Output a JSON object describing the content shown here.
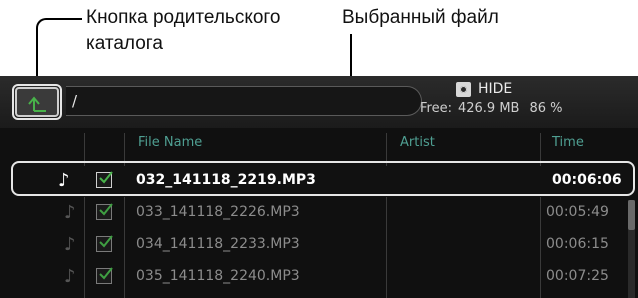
{
  "callouts": {
    "parent_dir_line1": "Кнопка родительского",
    "parent_dir_line2": "каталога",
    "selected_file": "Выбранный файл"
  },
  "toolbar": {
    "path": "/",
    "hide_label": "HIDE",
    "free_label": "Free:",
    "free_size": "426.9 MB",
    "free_percent": "86 %"
  },
  "table": {
    "columns": [
      "File Name",
      "Artist",
      "Time"
    ],
    "rows": [
      {
        "file": "032_141118_2219.MP3",
        "artist": "",
        "time": "00:06:06",
        "selected": true,
        "checked": true
      },
      {
        "file": "033_141118_2226.MP3",
        "artist": "",
        "time": "00:05:49",
        "selected": false,
        "checked": true
      },
      {
        "file": "034_141118_2233.MP3",
        "artist": "",
        "time": "00:06:15",
        "selected": false,
        "checked": true
      },
      {
        "file": "035_141118_2240.MP3",
        "artist": "",
        "time": "00:07:25",
        "selected": false,
        "checked": true
      }
    ]
  },
  "icons": {
    "parent": "up-arrow-icon",
    "hide": "hide-icon",
    "note": "music-note-icon",
    "check": "checkbox-checked-icon"
  },
  "colors": {
    "header_text": "#4f9f92",
    "selected_text": "#ffffff",
    "row_text": "#8c8c8c",
    "background": "#101010"
  }
}
